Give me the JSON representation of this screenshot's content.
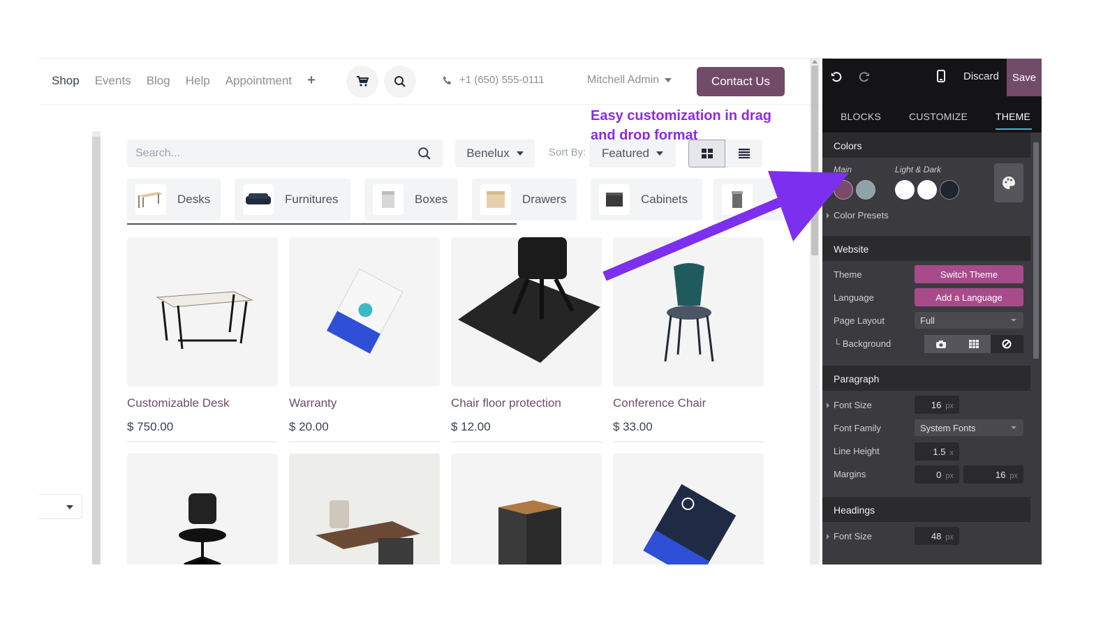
{
  "nav": {
    "menu": [
      "Shop",
      "Events",
      "Blog",
      "Help",
      "Appointment"
    ],
    "phone": "+1 (650) 555-0111",
    "user": "Mitchell Admin",
    "contact_label": "Contact Us"
  },
  "callout": {
    "line1": "Easy customization in drag",
    "line2": "and drop format"
  },
  "toolbar": {
    "search_placeholder": "Search...",
    "pricelist": "Benelux",
    "sort_label": "Sort By:",
    "sort_value": "Featured"
  },
  "categories": [
    "Desks",
    "Furnitures",
    "Boxes",
    "Drawers",
    "Cabinets"
  ],
  "products": [
    {
      "name": "Customizable Desk",
      "price": "$ 750.00"
    },
    {
      "name": "Warranty",
      "price": "$ 20.00"
    },
    {
      "name": "Chair floor protection",
      "price": "$ 12.00"
    },
    {
      "name": "Conference Chair",
      "price": "$ 33.00"
    }
  ],
  "editor": {
    "discard": "Discard",
    "save": "Save",
    "tabs": [
      "BLOCKS",
      "CUSTOMIZE",
      "THEME"
    ],
    "active_tab": "THEME",
    "colors": {
      "title": "Colors",
      "main_label": "Main",
      "light_dark_label": "Light & Dark",
      "presets_label": "Color Presets",
      "main_swatches": [
        "#7b4a6b",
        "#8fa2a8"
      ],
      "light_dark_swatches": [
        "#ffffff",
        "#ffffff",
        "#1f2430"
      ]
    },
    "website": {
      "title": "Website",
      "theme_label": "Theme",
      "theme_button": "Switch Theme",
      "language_label": "Language",
      "language_button": "Add a Language",
      "layout_label": "Page Layout",
      "layout_value": "Full",
      "background_label": "Background"
    },
    "paragraph": {
      "title": "Paragraph",
      "font_size_label": "Font Size",
      "font_size": "16",
      "font_family_label": "Font Family",
      "font_family": "System Fonts",
      "line_height_label": "Line Height",
      "line_height": "1.5",
      "margins_label": "Margins",
      "margin_top": "0",
      "margin_bottom": "16",
      "unit_px": "px",
      "unit_x": "x"
    },
    "headings": {
      "title": "Headings",
      "font_size_label": "Font Size",
      "font_size": "48"
    }
  },
  "colors": {
    "brand": "#714b67",
    "accent_pink": "#a84b8b",
    "callout": "#8b2be2",
    "arrow": "#7c2fee",
    "tab_underline": "#3eb9c4"
  }
}
